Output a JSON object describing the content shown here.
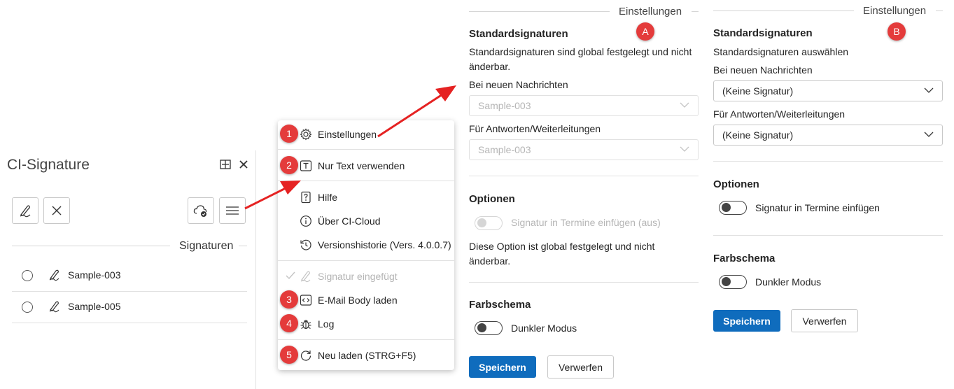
{
  "addin": {
    "title": "CI-Signature",
    "signatures_section": "Signaturen",
    "signatures": [
      {
        "name": "Sample-003"
      },
      {
        "name": "Sample-005"
      }
    ]
  },
  "menu": {
    "items": [
      {
        "label": "Einstellungen",
        "badge": "1",
        "icon": "gear-icon"
      },
      {
        "label": "Nur Text verwenden",
        "badge": "2",
        "icon": "text-icon"
      },
      {
        "label": "Hilfe",
        "icon": "help-icon"
      },
      {
        "label": "Über CI-Cloud",
        "icon": "info-icon"
      },
      {
        "label": "Versionshistorie (Vers. 4.0.0.7)",
        "icon": "history-icon"
      },
      {
        "label": "Signatur eingefügt",
        "icon": "check-signature-icon",
        "disabled": true
      },
      {
        "label": "E-Mail Body laden",
        "badge": "3",
        "icon": "code-icon"
      },
      {
        "label": "Log",
        "badge": "4",
        "icon": "bug-icon"
      },
      {
        "label": "Neu laden (STRG+F5)",
        "badge": "5",
        "icon": "reload-icon"
      }
    ]
  },
  "panel_a": {
    "badge": "A",
    "header": "Einstellungen",
    "std_title": "Standardsignaturen",
    "std_desc": "Standardsignaturen sind global festgelegt und nicht änderbar.",
    "new_label": "Bei neuen Nachrichten",
    "new_value": "Sample-003",
    "reply_label": "Für Antworten/Weiterleitungen",
    "reply_value": "Sample-003",
    "options_title": "Optionen",
    "toggle_label": "Signatur in Termine einfügen (aus)",
    "options_note": "Diese Option ist global festgelegt und nicht änderbar.",
    "scheme_title": "Farbschema",
    "dark_label": "Dunkler Modus",
    "save": "Speichern",
    "discard": "Verwerfen"
  },
  "panel_b": {
    "badge": "B",
    "header": "Einstellungen",
    "std_title": "Standardsignaturen",
    "std_desc": "Standardsignaturen auswählen",
    "new_label": "Bei neuen Nachrichten",
    "new_value": "(Keine Signatur)",
    "reply_label": "Für Antworten/Weiterleitungen",
    "reply_value": "(Keine Signatur)",
    "options_title": "Optionen",
    "toggle_label": "Signatur in Termine einfügen",
    "scheme_title": "Farbschema",
    "dark_label": "Dunkler Modus",
    "save": "Speichern",
    "discard": "Verwerfen"
  },
  "colors": {
    "accent": "#0f6cbd",
    "badge": "#e43b3b",
    "arrow": "#e52222"
  }
}
